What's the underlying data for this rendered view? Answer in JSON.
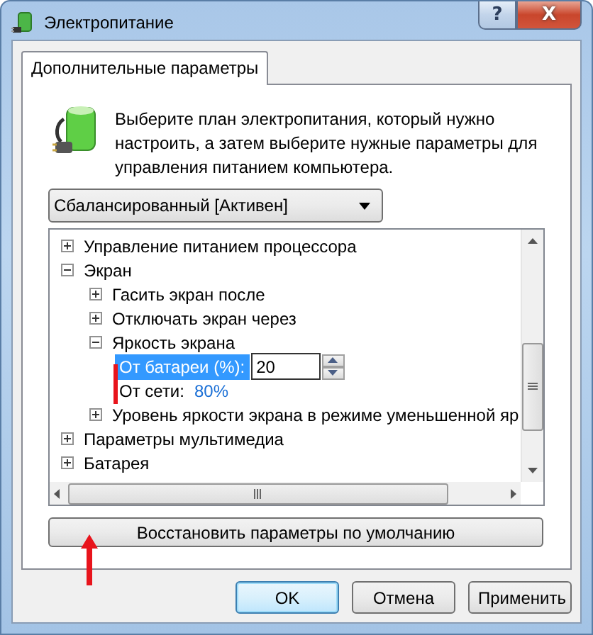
{
  "window": {
    "title": "Электропитание",
    "buttons": [
      {
        "kind": "help",
        "label": "?"
      },
      {
        "kind": "close",
        "label": "X"
      }
    ]
  },
  "tabs": [
    {
      "label": "Дополнительные параметры",
      "selected": true
    }
  ],
  "description": "Выберите план электропитания, который нужно настроить, а затем выберите нужные параметры для управления питанием компьютера.",
  "plan_select": {
    "value": "Сбалансированный [Активен]"
  },
  "tree": [
    {
      "label": "Управление питанием процессора",
      "expanded": false
    },
    {
      "label": "Экран",
      "expanded": true,
      "children": [
        {
          "label": "Гасить экран после",
          "expanded": false
        },
        {
          "label": "Отключать экран через",
          "expanded": false
        },
        {
          "label": "Яркость экрана",
          "expanded": true,
          "children": [
            {
              "kind": "spin",
              "label": "От батареи (%):",
              "value": "20",
              "selected": true
            },
            {
              "kind": "value",
              "label": "От сети:",
              "value": "80%",
              "selected": false
            }
          ]
        },
        {
          "label": "Уровень яркости экрана в режиме уменьшенной яр",
          "expanded": false
        }
      ]
    },
    {
      "label": "Параметры мультимедиа",
      "expanded": false
    },
    {
      "label": "Батарея",
      "expanded": false
    }
  ],
  "restore_button": "Восстановить параметры по умолчанию",
  "buttons": [
    {
      "label": "OK",
      "default": true
    },
    {
      "label": "Отмена",
      "default": false
    },
    {
      "label": "Применить",
      "default": false
    }
  ]
}
